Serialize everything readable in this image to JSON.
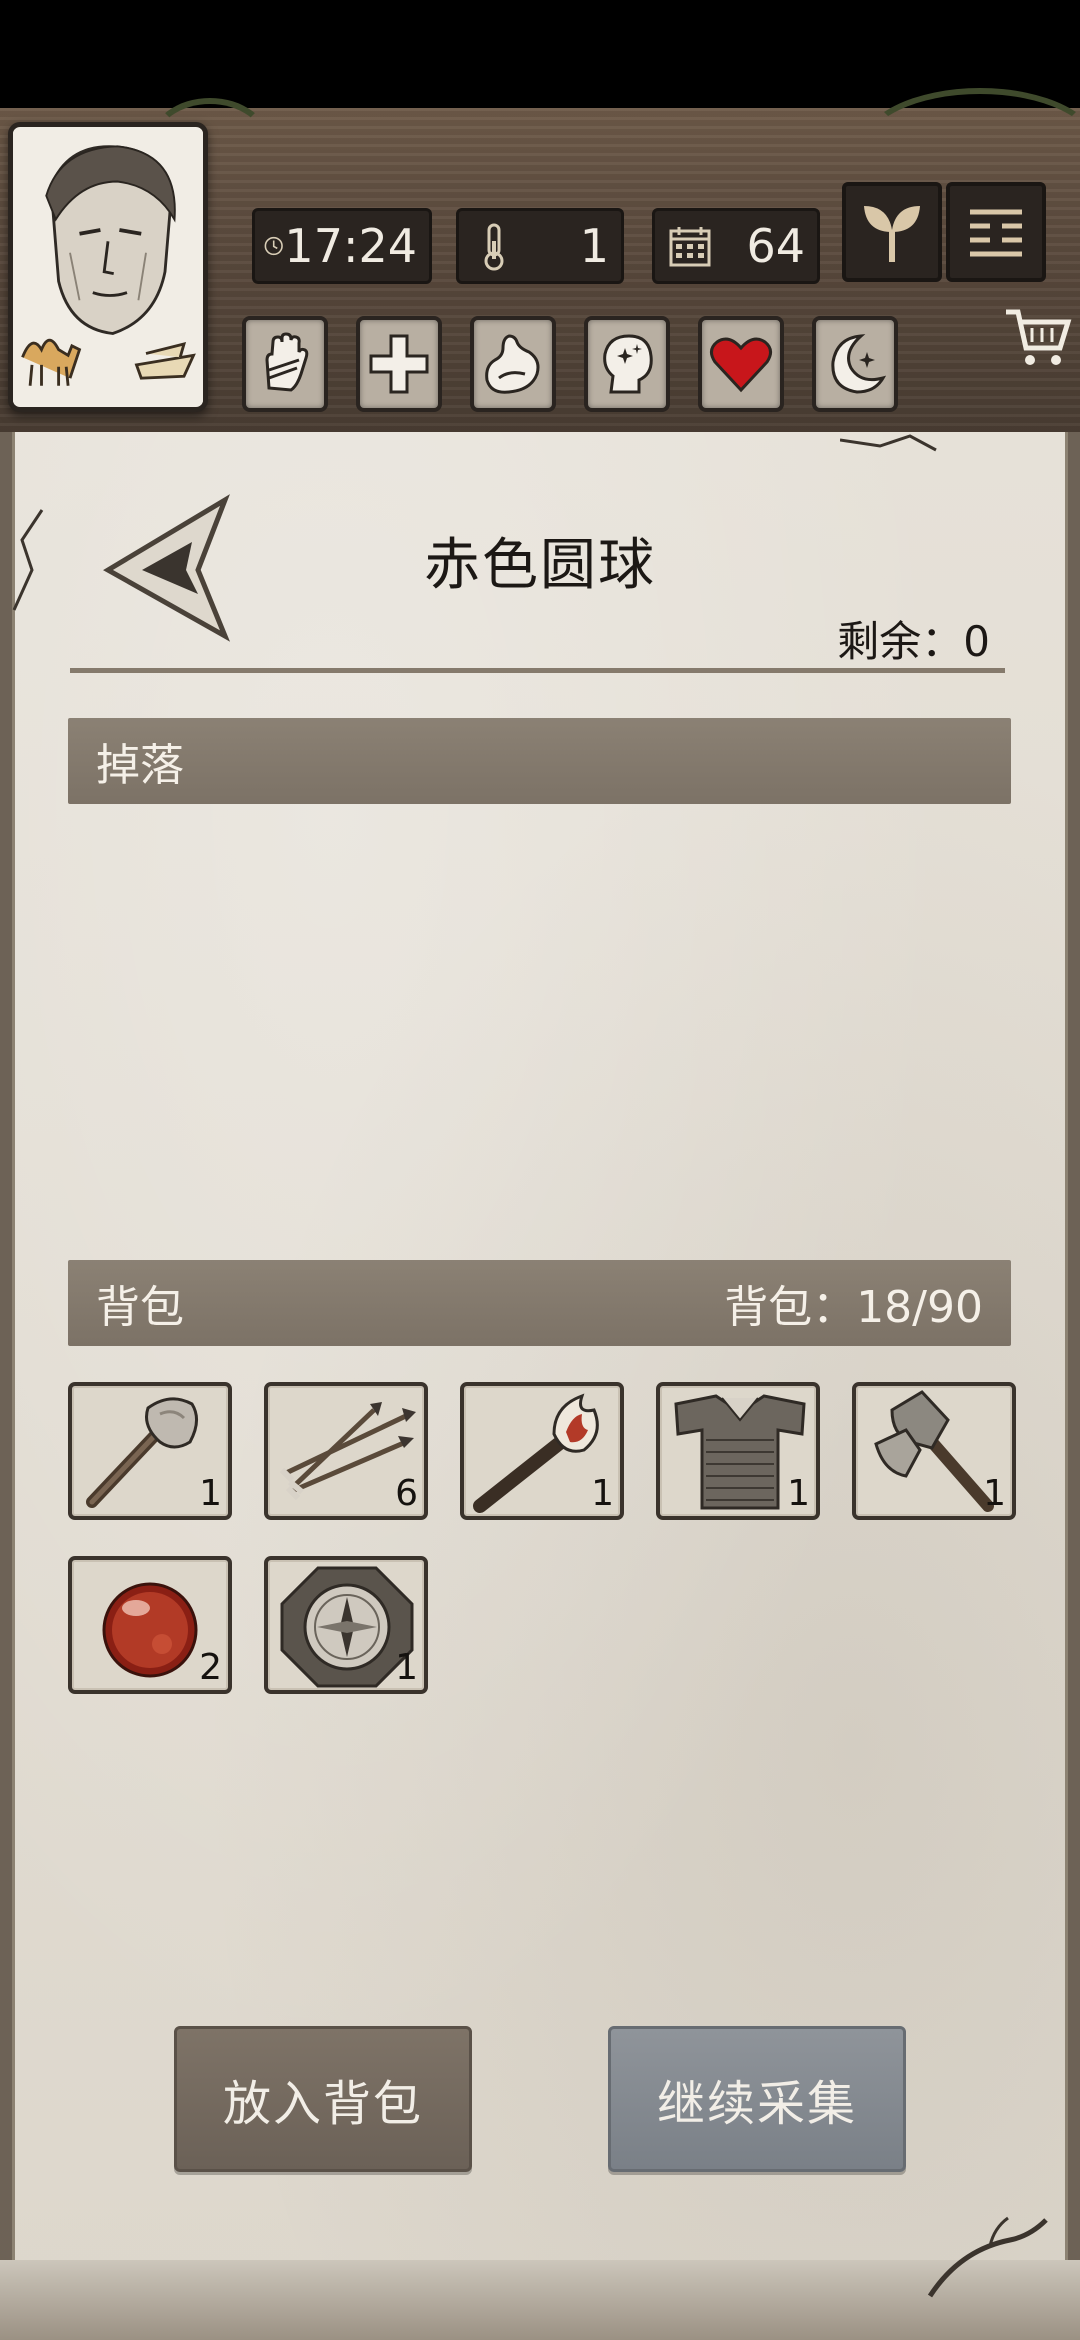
{
  "hud": {
    "time": "17:24",
    "temperature": "1",
    "day": "64",
    "status_icons": [
      "hand-icon",
      "cross-icon",
      "stomach-icon",
      "head-icon",
      "heart-icon",
      "moon-icon"
    ],
    "top_right_buttons": [
      "sprout-icon",
      "menu-icon"
    ],
    "cart": "cart-icon"
  },
  "header": {
    "title": "赤色圆球",
    "remaining_label": "剩余：",
    "remaining_value": "0"
  },
  "drop_section": {
    "title": "掉落",
    "items": []
  },
  "backpack_section": {
    "title": "背包",
    "capacity_label": "背包：",
    "capacity": "18/90"
  },
  "backpack_items": [
    {
      "name": "stone-axe",
      "count": "1"
    },
    {
      "name": "arrows",
      "count": "6"
    },
    {
      "name": "torch",
      "count": "1"
    },
    {
      "name": "chainmail",
      "count": "1"
    },
    {
      "name": "iron-axe",
      "count": "1"
    },
    {
      "name": "red-orb",
      "count": "2"
    },
    {
      "name": "compass",
      "count": "1"
    }
  ],
  "actions": {
    "put_in_bag": "放入背包",
    "continue_gather": "继续采集"
  },
  "colors": {
    "paper": "#e2ddd3",
    "section_bar": "#837a6e",
    "heart": "#c8161b",
    "button_put": "#756b60",
    "button_continue": "#858a90"
  }
}
